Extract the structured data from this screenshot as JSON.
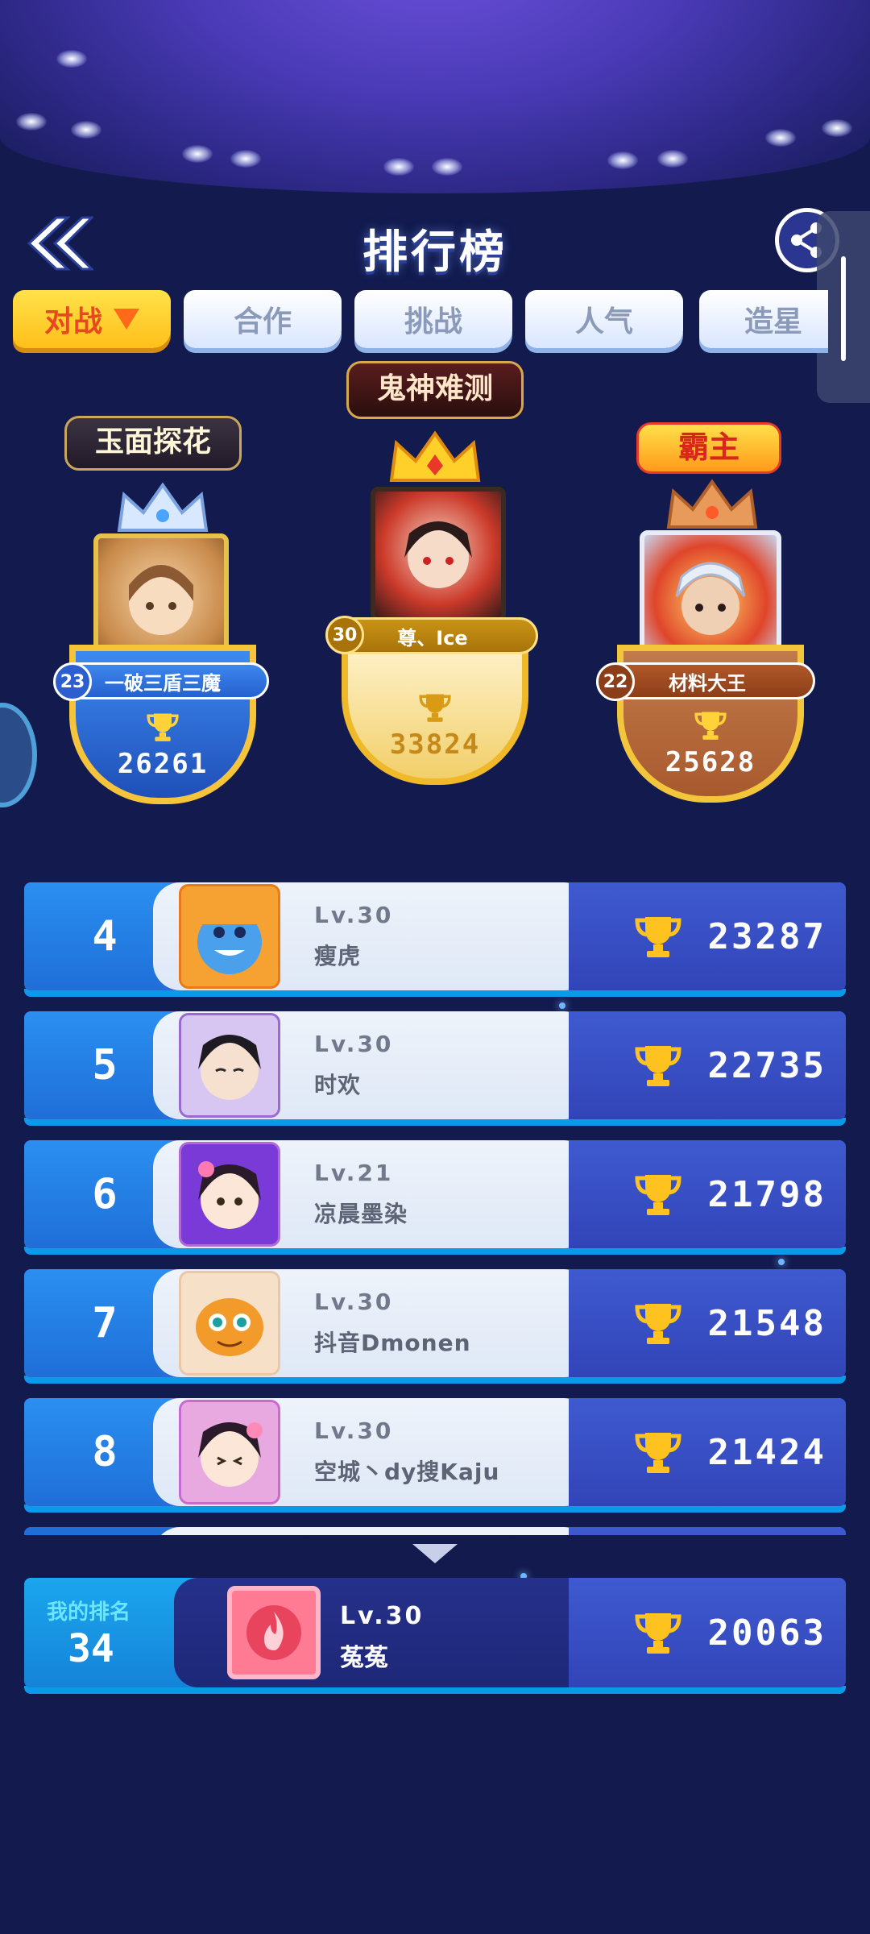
{
  "header": {
    "title": "排行榜"
  },
  "tabs": [
    {
      "label": "对战",
      "active": true
    },
    {
      "label": "合作",
      "active": false
    },
    {
      "label": "挑战",
      "active": false
    },
    {
      "label": "人气",
      "active": false
    },
    {
      "label": "造星",
      "active": false
    }
  ],
  "podium": {
    "first": {
      "title_badge": "鬼神难测",
      "level": "30",
      "name": "尊、Ice",
      "score": "33824"
    },
    "second": {
      "title_badge": "玉面探花",
      "level": "23",
      "name": "一破三盾三魔",
      "score": "26261"
    },
    "third": {
      "title_badge": "霸主",
      "level": "22",
      "name": "材料大王",
      "score": "25628"
    }
  },
  "list": [
    {
      "rank": "4",
      "level": "Lv.30",
      "name": "瘦虎",
      "score": "23287"
    },
    {
      "rank": "5",
      "level": "Lv.30",
      "name": "时欢",
      "score": "22735"
    },
    {
      "rank": "6",
      "level": "Lv.21",
      "name": "凉晨墨染",
      "score": "21798"
    },
    {
      "rank": "7",
      "level": "Lv.30",
      "name": "抖音Dmonen",
      "score": "21548"
    },
    {
      "rank": "8",
      "level": "Lv.30",
      "name": "空城丶dy搜Kaju",
      "score": "21424"
    }
  ],
  "my_rank": {
    "label": "我的排名",
    "rank": "34",
    "level": "Lv.30",
    "name": "菟菟",
    "score": "20063"
  },
  "colors": {
    "background": "#121a4e",
    "tab_active": "#ffc21f",
    "tab_active_text": "#e8481f",
    "rank_blue": "#2a8ff0",
    "score_block": "#3a4fc4",
    "gold": "#f2c53b"
  }
}
